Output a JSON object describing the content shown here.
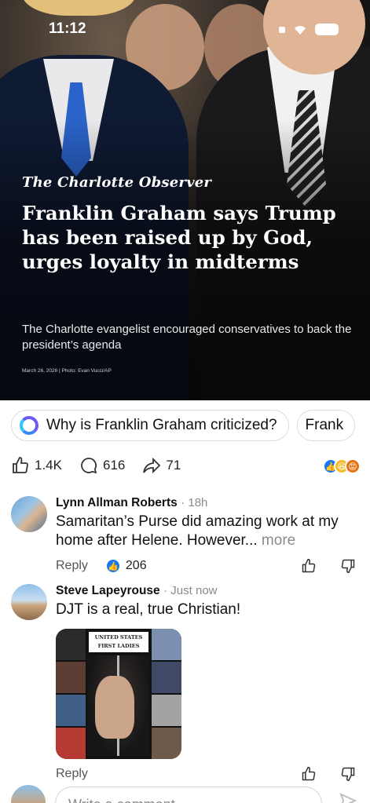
{
  "status": {
    "time": "11:12"
  },
  "article": {
    "source": "The Charlotte Observer",
    "headline": "Franklin Graham says Trump has been raised up by God, urges loyalty in midterms",
    "dek": "The Charlotte evangelist encouraged conservatives to back the president’s agenda",
    "credit": "March 26, 2026 | Photo: Evan Vucci/AP"
  },
  "chips": [
    {
      "label": "Why is Franklin Graham criticized?"
    },
    {
      "label": "Frank"
    }
  ],
  "actions": {
    "likes": "1.4K",
    "comments": "616",
    "shares": "71"
  },
  "colors": {
    "like_blue": "#1877f2",
    "haha_yellow": "#f7b928",
    "angry_orange": "#e9710f",
    "gray": "#8a8a8a"
  },
  "comments": [
    {
      "name": "Lynn Allman Roberts",
      "meta": "· 18h",
      "text": "Samaritan’s Purse did amazing work at my home after Helene. However...",
      "more": "more",
      "reply": "Reply",
      "likes": "206"
    },
    {
      "name": "Steve Lapeyrouse",
      "meta": "· Just now",
      "text": "DJT is a real, true Christian!",
      "image_banner": "UNITED STATES FIRST LADIES",
      "reply": "Reply"
    }
  ],
  "compose": {
    "placeholder": "Write a comment..."
  }
}
